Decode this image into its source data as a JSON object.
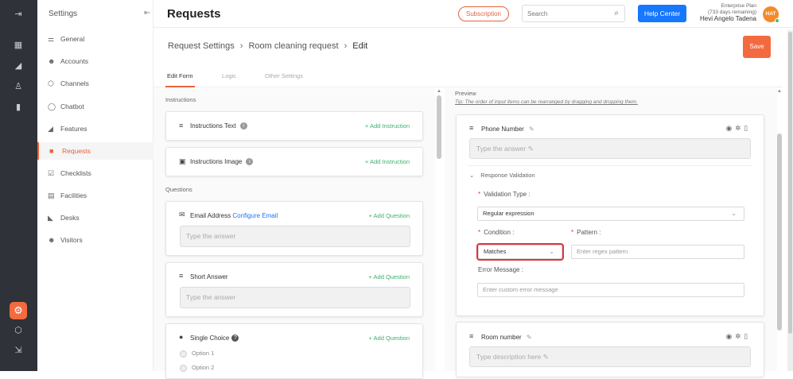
{
  "app": {
    "title": "Requests"
  },
  "rail": {
    "icons": [
      "menu-icon",
      "dashboard-icon",
      "megaphone-icon",
      "analytics-icon",
      "chart-icon",
      "settings-icon",
      "box-icon",
      "logout-icon"
    ]
  },
  "settings_nav": {
    "heading": "Settings",
    "items": [
      {
        "label": "General",
        "icon": "sliders-icon"
      },
      {
        "label": "Accounts",
        "icon": "users-icon"
      },
      {
        "label": "Channels",
        "icon": "cube-icon"
      },
      {
        "label": "Chatbot",
        "icon": "chat-icon"
      },
      {
        "label": "Features",
        "icon": "megaphone-icon"
      },
      {
        "label": "Requests",
        "icon": "request-icon",
        "active": true
      },
      {
        "label": "Checklists",
        "icon": "checklist-icon"
      },
      {
        "label": "Facilities",
        "icon": "building-icon"
      },
      {
        "label": "Desks",
        "icon": "desk-icon"
      },
      {
        "label": "Visitors",
        "icon": "visitors-icon"
      }
    ]
  },
  "header": {
    "subscription_label": "Subscription",
    "search_placeholder": "Search",
    "help_label": "Help Center",
    "plan_name": "Enterprise Plan",
    "plan_remaining": "(733 days remaining)",
    "user_name": "Hevi Angelo Tadena",
    "avatar_initials": "HAT"
  },
  "breadcrumb": {
    "items": [
      "Request Settings",
      "Room cleaning request",
      "Edit"
    ]
  },
  "save_label": "Save",
  "tabs": [
    "Edit Form",
    "Logic",
    "Other Settings"
  ],
  "form": {
    "instructions_heading": "Instructions",
    "questions_heading": "Questions",
    "instruction_cards": [
      {
        "label": "Instructions Text",
        "action": "+ Add Instruction"
      },
      {
        "label": "Instructions Image",
        "action": "+ Add Instruction"
      }
    ],
    "question_cards": [
      {
        "label": "Email Address",
        "link": "Configure Email",
        "action": "+ Add Question",
        "placeholder": "Type the answer"
      },
      {
        "label": "Short Answer",
        "action": "+ Add Question",
        "placeholder": "Type the answer"
      },
      {
        "label": "Single Choice",
        "action": "+ Add Question",
        "options": [
          "Option 1",
          "Option 2"
        ]
      }
    ]
  },
  "preview": {
    "heading": "Preview",
    "tip": "Tip: The order of input items can be rearranged by dragging and dropping them.",
    "card1": {
      "title": "Phone Number",
      "placeholder": "Type the answer",
      "validation_label": "Response Validation",
      "validation_type_label": "Validation Type :",
      "validation_type_value": "Regular expression",
      "condition_label": "Condition :",
      "condition_value": "Matches",
      "pattern_label": "Pattern :",
      "pattern_placeholder": "Enter regex pattern",
      "error_label": "Error Message :",
      "error_placeholder": "Enter custom error message"
    },
    "card2": {
      "title": "Room number",
      "placeholder": "Type description here"
    }
  },
  "colors": {
    "accent": "#e8623a",
    "save": "#f36a3e",
    "help": "#1677ff",
    "add_link": "#3caf6c",
    "sidebar_dark": "#2f3238",
    "highlight": "#e0333e"
  }
}
